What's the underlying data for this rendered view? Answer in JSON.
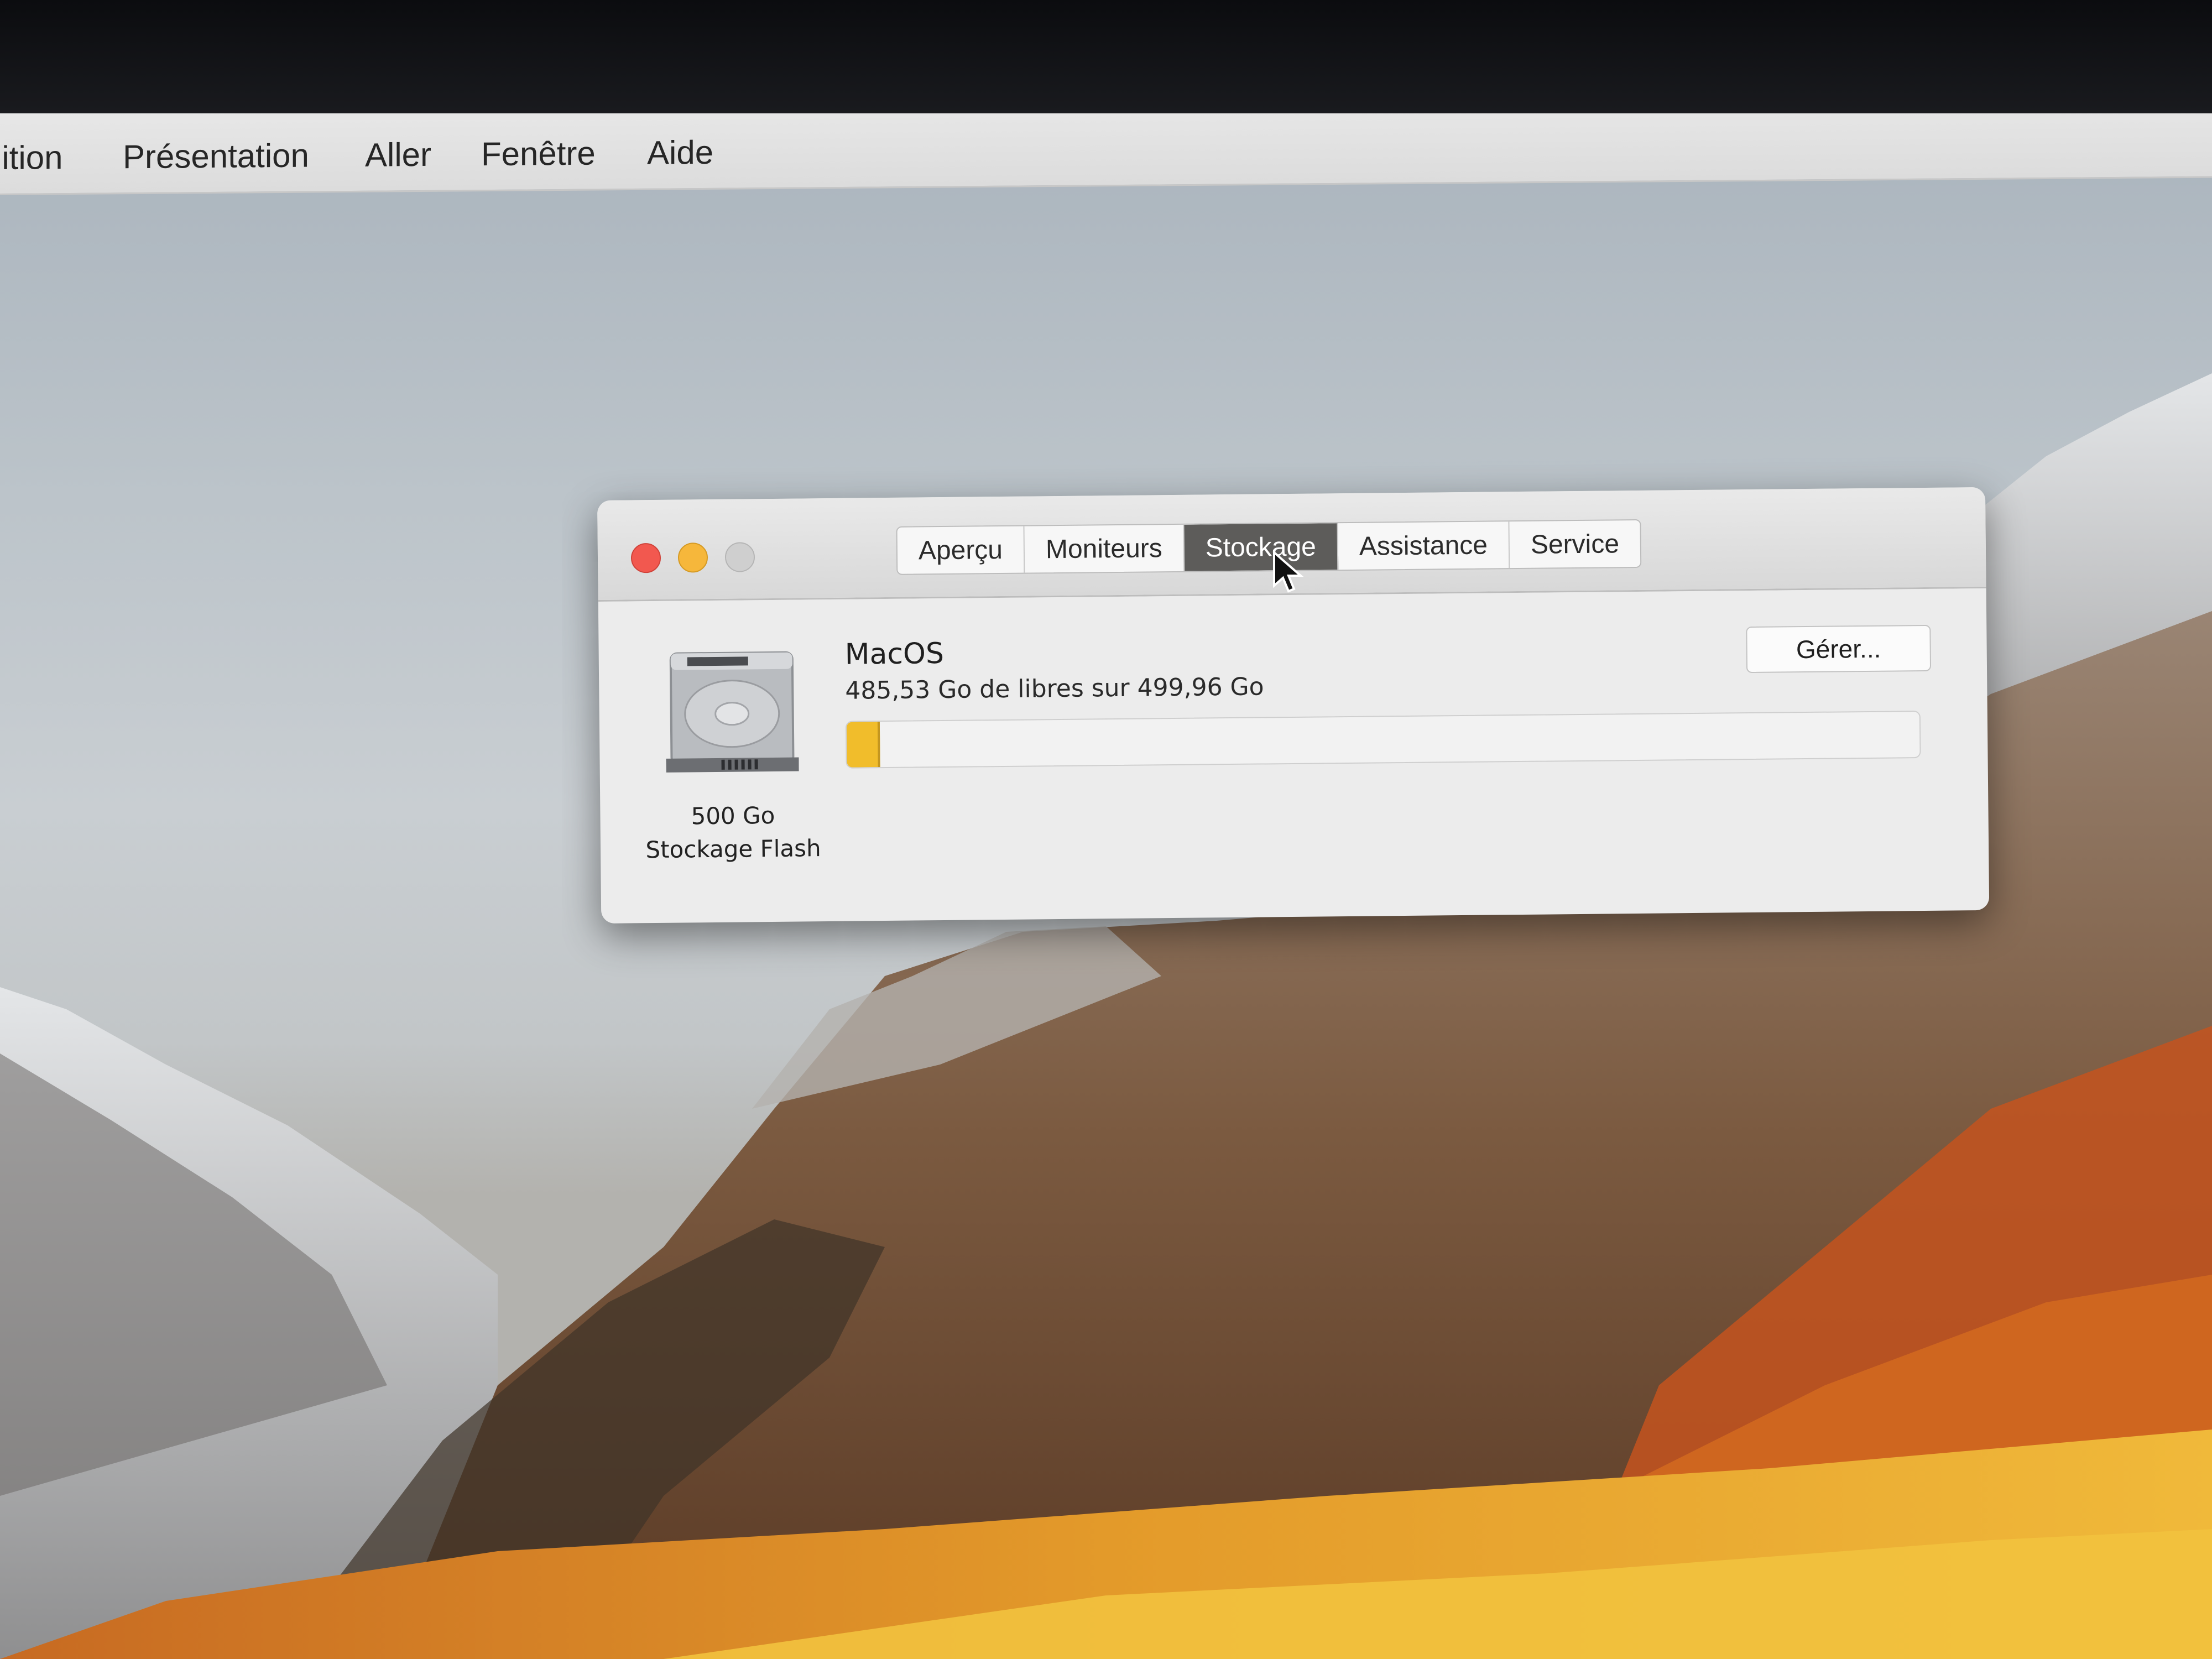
{
  "menubar": {
    "items": [
      "dition",
      "Présentation",
      "Aller",
      "Fenêtre",
      "Aide"
    ]
  },
  "window": {
    "tabs": [
      {
        "label": "Aperçu",
        "active": false
      },
      {
        "label": "Moniteurs",
        "active": false
      },
      {
        "label": "Stockage",
        "active": true
      },
      {
        "label": "Assistance",
        "active": false
      },
      {
        "label": "Service",
        "active": false
      }
    ],
    "disk": {
      "icon": "hard-drive-icon",
      "size_label": "500 Go",
      "kind_label": "Stockage Flash"
    },
    "volume": {
      "name": "MacOS",
      "free_text": "485,53 Go de libres sur 499,96 Go",
      "used_fraction": 0.029
    },
    "manage_label": "Gérer..."
  },
  "colors": {
    "used_bar": "#f1bd2b",
    "active_tab": "#5d5c5a",
    "close": "#f2584f",
    "minimize": "#f6b73b",
    "zoom": "#cfcfcf"
  }
}
